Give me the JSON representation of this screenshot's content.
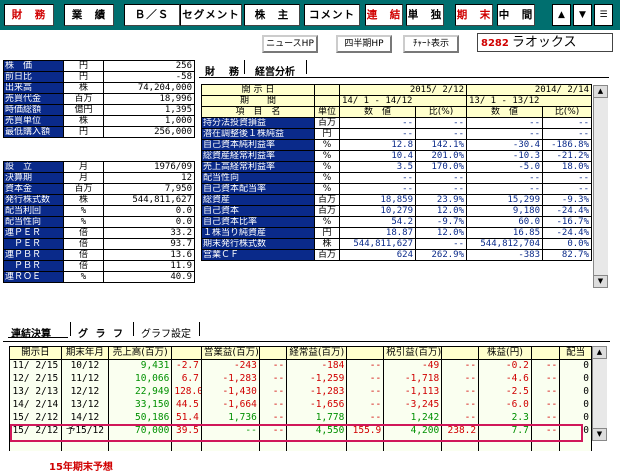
{
  "toolbar": {
    "financial": "財　務",
    "industry": "業　績",
    "bs": "Ｂ／Ｓ",
    "segment": "セグメント",
    "shareholder": "株　主",
    "comment": "コメント",
    "consolidated": "連　結",
    "standalone": "単　独",
    "fiscal_end": "期　末",
    "interim": "中　間",
    "up_arrow": "▲",
    "down_arrow": "▼",
    "menu": "☰"
  },
  "sub": {
    "news_hp": "ニュースHP",
    "quarter_hp": "四半期HP",
    "chart_show": "ﾁｬｰﾄ表示",
    "code": "8282",
    "company": "ラオックス"
  },
  "left1": [
    {
      "name": "株　価",
      "unit": "円",
      "value": "256"
    },
    {
      "name": "前日比",
      "unit": "円",
      "value": "-58"
    },
    {
      "name": "出来高",
      "unit": "株",
      "value": "74,204,000"
    },
    {
      "name": "売買代金",
      "unit": "百万",
      "value": "18,996"
    },
    {
      "name": "時価総額",
      "unit": "億円",
      "value": "1,395"
    },
    {
      "name": "売買単位",
      "unit": "株",
      "value": "1,000"
    },
    {
      "name": "最低購入額",
      "unit": "円",
      "value": "256,000"
    }
  ],
  "left2": [
    {
      "name": "設　立",
      "unit": "月",
      "value": "1976/09"
    },
    {
      "name": "決算期",
      "unit": "月",
      "value": "12"
    },
    {
      "name": "資本金",
      "unit": "百万",
      "value": "7,950"
    },
    {
      "name": "発行株式数",
      "unit": "株",
      "value": "544,811,627"
    },
    {
      "name": "配当利回",
      "unit": "%",
      "value": "0.0"
    },
    {
      "name": "配当性向",
      "unit": "%",
      "value": "0.0"
    },
    {
      "name": "連ＰＥＲ",
      "unit": "倍",
      "value": "33.2"
    },
    {
      "name": "　ＰＥＲ",
      "unit": "倍",
      "value": "93.7"
    },
    {
      "name": "連ＰＢＲ",
      "unit": "倍",
      "value": "13.6"
    },
    {
      "name": "　ＰＢＲ",
      "unit": "倍",
      "value": "11.9"
    },
    {
      "name": "連ＲＯＥ",
      "unit": "%",
      "value": "40.9"
    }
  ],
  "panel_tabs": {
    "financial": "財　務",
    "analysis": "経営分析"
  },
  "right": {
    "h_date": "開 示 日",
    "h_period": "期　　間",
    "h_item": "項　目　名",
    "h_unit": "単位",
    "d1": "2015/ 2/12",
    "p1": "14/ 1 - 14/12",
    "d2": "2014/ 2/14",
    "p2": "13/ 1 - 13/12",
    "c_val": "数　値",
    "c_ratio": "比(%)",
    "c_val2": "数　値",
    "c_ratio2": "比(%)",
    "rows": [
      {
        "name": "持分法投資損益",
        "unit": "百万",
        "v1": "--",
        "r1": "--",
        "v2": "--",
        "r2": "--"
      },
      {
        "name": "潜在調整後１株純益",
        "unit": "円",
        "v1": "--",
        "r1": "--",
        "v2": "--",
        "r2": "--"
      },
      {
        "name": "自己資本純利益率",
        "unit": "%",
        "v1": "12.8",
        "r1": "142.1%",
        "v2": "-30.4",
        "r2": "-186.8%"
      },
      {
        "name": "総資産経常利益率",
        "unit": "%",
        "v1": "10.4",
        "r1": "201.0%",
        "v2": "-10.3",
        "r2": "-21.2%"
      },
      {
        "name": "売上高経常利益率",
        "unit": "%",
        "v1": "3.5",
        "r1": "170.0%",
        "v2": "-5.0",
        "r2": "18.0%"
      },
      {
        "name": "配当性向",
        "unit": "%",
        "v1": "--",
        "r1": "--",
        "v2": "--",
        "r2": "--"
      },
      {
        "name": "自己資本配当率",
        "unit": "%",
        "v1": "--",
        "r1": "--",
        "v2": "--",
        "r2": "--"
      },
      {
        "name": "総資産",
        "unit": "百万",
        "v1": "18,859",
        "r1": "23.9%",
        "v2": "15,299",
        "r2": "-9.3%"
      },
      {
        "name": "自己資本",
        "unit": "百万",
        "v1": "10,279",
        "r1": "12.0%",
        "v2": "9,180",
        "r2": "-24.4%"
      },
      {
        "name": "自己資本比率",
        "unit": "%",
        "v1": "54.2",
        "r1": "-9.7%",
        "v2": "60.0",
        "r2": "-16.7%"
      },
      {
        "name": "１株当り純資産",
        "unit": "円",
        "v1": "18.87",
        "r1": "12.0%",
        "v2": "16.85",
        "r2": "-24.4%"
      },
      {
        "name": "期末発行株式数",
        "unit": "株",
        "v1": "544,811,627",
        "r1": "--",
        "v2": "544,812,704",
        "r2": "0.0%"
      },
      {
        "name": "営業ＣＦ",
        "unit": "百万",
        "v1": "624",
        "r1": "262.9%",
        "v2": "-383",
        "r2": "82.7%"
      }
    ]
  },
  "bottom_tabs": {
    "consolidated": "連結決算",
    "graph": "グ ラ フ",
    "graph_settings": "グラフ設定"
  },
  "bottom": {
    "headers": [
      "開示日",
      "期末年月",
      "売上高(百万)",
      "",
      "営業益(百万)",
      "",
      "経常益(百万)",
      "",
      "税引益(百万)",
      "",
      "株益(円)",
      "",
      "配当"
    ],
    "rows": [
      {
        "date": "11/ 2/15",
        "period": "10/12",
        "sales": "9,431",
        "s_pct": "-2.7",
        "op": "-243",
        "op_pct": "--",
        "ord": "-184",
        "ord_pct": "--",
        "net": "-49",
        "net_pct": "--",
        "eps": "-0.2",
        "eps_pct": "--",
        "div": "0"
      },
      {
        "date": "12/ 2/15",
        "period": "11/12",
        "sales": "10,066",
        "s_pct": "6.7",
        "op": "-1,283",
        "op_pct": "--",
        "ord": "-1,259",
        "ord_pct": "--",
        "net": "-1,718",
        "net_pct": "--",
        "eps": "-4.6",
        "eps_pct": "--",
        "div": "0"
      },
      {
        "date": "13/ 2/13",
        "period": "12/12",
        "sales": "22,949",
        "s_pct": "128.0",
        "op": "-1,430",
        "op_pct": "--",
        "ord": "-1,283",
        "ord_pct": "--",
        "net": "-1,113",
        "net_pct": "--",
        "eps": "-2.5",
        "eps_pct": "--",
        "div": "0"
      },
      {
        "date": "14/ 2/14",
        "period": "13/12",
        "sales": "33,150",
        "s_pct": "44.5",
        "op": "-1,664",
        "op_pct": "--",
        "ord": "-1,656",
        "ord_pct": "--",
        "net": "-3,245",
        "net_pct": "--",
        "eps": "-6.0",
        "eps_pct": "--",
        "div": "0"
      },
      {
        "date": "15/ 2/12",
        "period": "14/12",
        "sales": "50,186",
        "s_pct": "51.4",
        "op": "1,736",
        "op_pct": "--",
        "ord": "1,778",
        "ord_pct": "--",
        "net": "1,242",
        "net_pct": "--",
        "eps": "2.3",
        "eps_pct": "--",
        "div": "0"
      },
      {
        "date": "15/ 2/12",
        "period": "予15/12",
        "sales": "70,000",
        "s_pct": "39.5",
        "op": "--",
        "op_pct": "--",
        "ord": "4,550",
        "ord_pct": "155.9",
        "net": "4,200",
        "net_pct": "238.2",
        "eps": "7.7",
        "eps_pct": "--",
        "div": "0"
      }
    ]
  },
  "footnote": "15年期末予想",
  "colors": {
    "toolbar_bg": "#006f6f",
    "label_bg": "#0a2a8a",
    "header_bg": "#ffffcc",
    "red": "#d00000",
    "green": "#009000",
    "highlight": "#d0185a"
  }
}
